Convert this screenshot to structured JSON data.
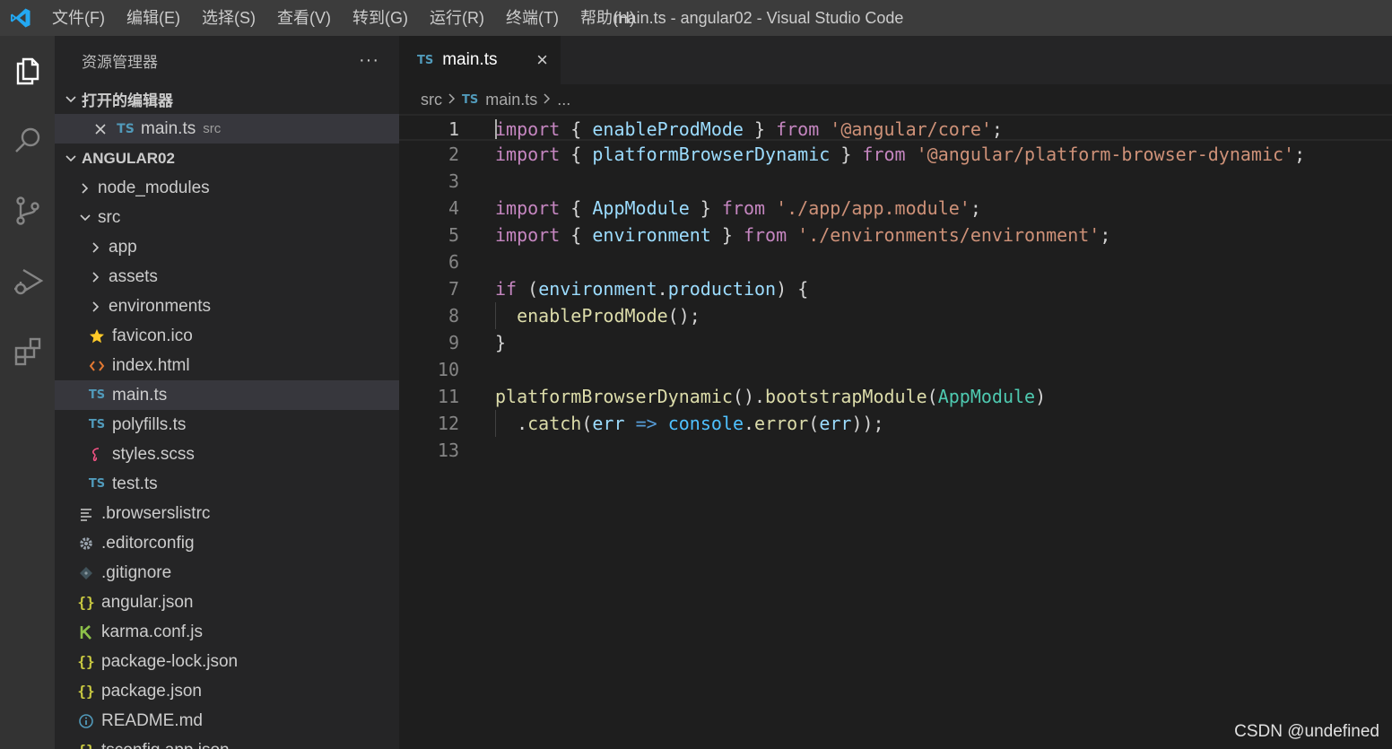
{
  "window": {
    "title": "main.ts - angular02 - Visual Studio Code"
  },
  "menu": [
    "文件(F)",
    "编辑(E)",
    "选择(S)",
    "查看(V)",
    "转到(G)",
    "运行(R)",
    "终端(T)",
    "帮助(H)"
  ],
  "sidebar": {
    "title": "资源管理器",
    "more": "···",
    "open_editors": {
      "label": "打开的编辑器",
      "items": [
        {
          "badge": "TS",
          "name": "main.ts",
          "desc": "src"
        }
      ]
    },
    "project": {
      "label": "ANGULAR02",
      "tree": [
        {
          "name": "node_modules",
          "type": "folder",
          "expanded": false,
          "depth": 1
        },
        {
          "name": "src",
          "type": "folder",
          "expanded": true,
          "depth": 1
        },
        {
          "name": "app",
          "type": "folder",
          "expanded": false,
          "depth": 2
        },
        {
          "name": "assets",
          "type": "folder",
          "expanded": false,
          "depth": 2
        },
        {
          "name": "environments",
          "type": "folder",
          "expanded": false,
          "depth": 2
        },
        {
          "name": "favicon.ico",
          "type": "file",
          "icon": "star-icon",
          "depth": 2
        },
        {
          "name": "index.html",
          "type": "file",
          "icon": "html-icon",
          "depth": 2
        },
        {
          "name": "main.ts",
          "type": "file",
          "icon": "ts-icon",
          "depth": 2,
          "selected": true
        },
        {
          "name": "polyfills.ts",
          "type": "file",
          "icon": "ts-icon",
          "depth": 2
        },
        {
          "name": "styles.scss",
          "type": "file",
          "icon": "sass-icon",
          "depth": 2
        },
        {
          "name": "test.ts",
          "type": "file",
          "icon": "ts-icon",
          "depth": 2
        },
        {
          "name": ".browserslistrc",
          "type": "file",
          "icon": "lines-icon",
          "depth": 1
        },
        {
          "name": ".editorconfig",
          "type": "file",
          "icon": "gear-icon",
          "depth": 1
        },
        {
          "name": ".gitignore",
          "type": "file",
          "icon": "git-icon",
          "depth": 1
        },
        {
          "name": "angular.json",
          "type": "file",
          "icon": "json-icon",
          "depth": 1
        },
        {
          "name": "karma.conf.js",
          "type": "file",
          "icon": "karma-icon",
          "depth": 1
        },
        {
          "name": "package-lock.json",
          "type": "file",
          "icon": "json-icon",
          "depth": 1
        },
        {
          "name": "package.json",
          "type": "file",
          "icon": "json-icon",
          "depth": 1
        },
        {
          "name": "README.md",
          "type": "file",
          "icon": "info-icon",
          "depth": 1
        },
        {
          "name": "tsconfig.app.json",
          "type": "file",
          "icon": "json-icon",
          "depth": 1
        }
      ]
    }
  },
  "editor": {
    "tab": {
      "badge": "TS",
      "label": "main.ts",
      "close": "×"
    },
    "breadcrumb": {
      "folder": "src",
      "badge": "TS",
      "file": "main.ts",
      "more": "..."
    },
    "lines": [
      [
        [
          "kw",
          "import"
        ],
        [
          "pn",
          " { "
        ],
        [
          "id",
          "enableProdMode"
        ],
        [
          "pn",
          " } "
        ],
        [
          "kw",
          "from"
        ],
        [
          "pn",
          " "
        ],
        [
          "str",
          "'@angular/core'"
        ],
        [
          "pn",
          ";"
        ]
      ],
      [
        [
          "kw",
          "import"
        ],
        [
          "pn",
          " { "
        ],
        [
          "id",
          "platformBrowserDynamic"
        ],
        [
          "pn",
          " } "
        ],
        [
          "kw",
          "from"
        ],
        [
          "pn",
          " "
        ],
        [
          "str",
          "'@angular/platform-browser-dynamic'"
        ],
        [
          "pn",
          ";"
        ]
      ],
      [],
      [
        [
          "kw",
          "import"
        ],
        [
          "pn",
          " { "
        ],
        [
          "id",
          "AppModule"
        ],
        [
          "pn",
          " } "
        ],
        [
          "kw",
          "from"
        ],
        [
          "pn",
          " "
        ],
        [
          "str",
          "'./app/app.module'"
        ],
        [
          "pn",
          ";"
        ]
      ],
      [
        [
          "kw",
          "import"
        ],
        [
          "pn",
          " { "
        ],
        [
          "id",
          "environment"
        ],
        [
          "pn",
          " } "
        ],
        [
          "kw",
          "from"
        ],
        [
          "pn",
          " "
        ],
        [
          "str",
          "'./environments/environment'"
        ],
        [
          "pn",
          ";"
        ]
      ],
      [],
      [
        [
          "ctl",
          "if"
        ],
        [
          "pn",
          " ("
        ],
        [
          "id",
          "environment"
        ],
        [
          "pn",
          "."
        ],
        [
          "id",
          "production"
        ],
        [
          "pn",
          ") {"
        ]
      ],
      [
        [
          "pn",
          "  "
        ],
        [
          "fn",
          "enableProdMode"
        ],
        [
          "pn",
          "();"
        ]
      ],
      [
        [
          "pn",
          "}"
        ]
      ],
      [],
      [
        [
          "fn",
          "platformBrowserDynamic"
        ],
        [
          "pn",
          "()."
        ],
        [
          "fn",
          "bootstrapModule"
        ],
        [
          "pn",
          "("
        ],
        [
          "cls",
          "AppModule"
        ],
        [
          "pn",
          ")"
        ]
      ],
      [
        [
          "pn",
          "  ."
        ],
        [
          "fn",
          "catch"
        ],
        [
          "pn",
          "("
        ],
        [
          "id",
          "err"
        ],
        [
          "pn",
          " "
        ],
        [
          "op",
          "=>"
        ],
        [
          "pn",
          " "
        ],
        [
          "blue",
          "console"
        ],
        [
          "pn",
          "."
        ],
        [
          "fn",
          "error"
        ],
        [
          "pn",
          "("
        ],
        [
          "id",
          "err"
        ],
        [
          "pn",
          "));"
        ]
      ],
      []
    ]
  },
  "watermark": "CSDN @undefined"
}
